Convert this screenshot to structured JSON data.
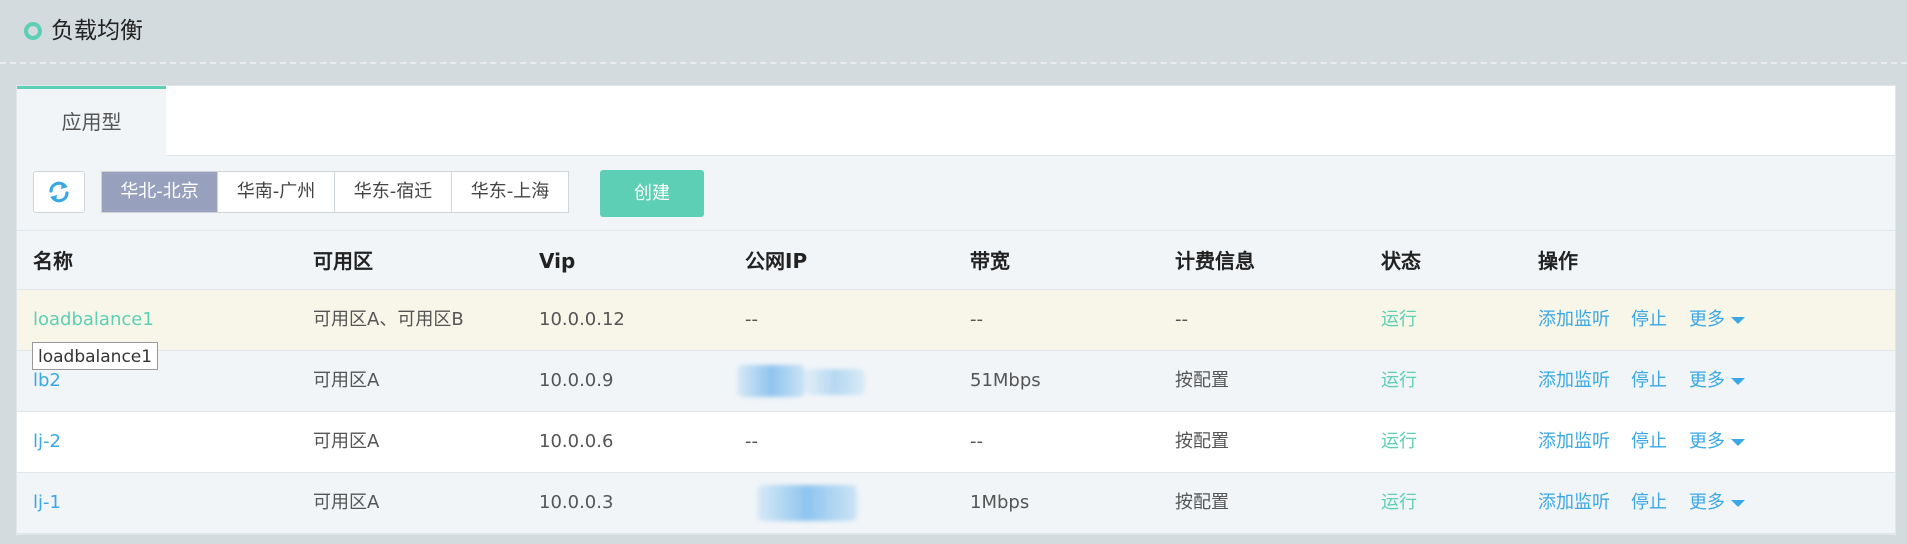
{
  "header": {
    "title": "负载均衡"
  },
  "tabs": [
    {
      "label": "应用型",
      "active": true
    }
  ],
  "toolbar": {
    "regions": [
      {
        "label": "华北-北京",
        "active": true
      },
      {
        "label": "华南-广州",
        "active": false
      },
      {
        "label": "华东-宿迁",
        "active": false
      },
      {
        "label": "华东-上海",
        "active": false
      }
    ],
    "create_label": "创建"
  },
  "table": {
    "columns": [
      "名称",
      "可用区",
      "Vip",
      "公网IP",
      "带宽",
      "计费信息",
      "状态",
      "操作"
    ],
    "rows": [
      {
        "name": "loadbalance1",
        "zone": "可用区A、可用区B",
        "vip": "10.0.0.12",
        "public_ip": "--",
        "bandwidth": "--",
        "billing": "--",
        "status": "运行"
      },
      {
        "name": "lb2",
        "zone": "可用区A",
        "vip": "10.0.0.9",
        "public_ip": "",
        "bandwidth": "51Mbps",
        "billing": "按配置",
        "status": "运行"
      },
      {
        "name": "lj-2",
        "zone": "可用区A",
        "vip": "10.0.0.6",
        "public_ip": "--",
        "bandwidth": "--",
        "billing": "按配置",
        "status": "运行"
      },
      {
        "name": "lj-1",
        "zone": "可用区A",
        "vip": "10.0.0.3",
        "public_ip": "",
        "bandwidth": "1Mbps",
        "billing": "按配置",
        "status": "运行"
      }
    ],
    "actions": {
      "add_listener": "添加监听",
      "stop": "停止",
      "more": "更多"
    }
  },
  "tooltip": {
    "text": "loadbalance1"
  },
  "colors": {
    "accent": "#5ccfb5",
    "link": "#3aa8e5",
    "region_active": "#97a0bd",
    "highlight_row": "#f8f6e8"
  }
}
